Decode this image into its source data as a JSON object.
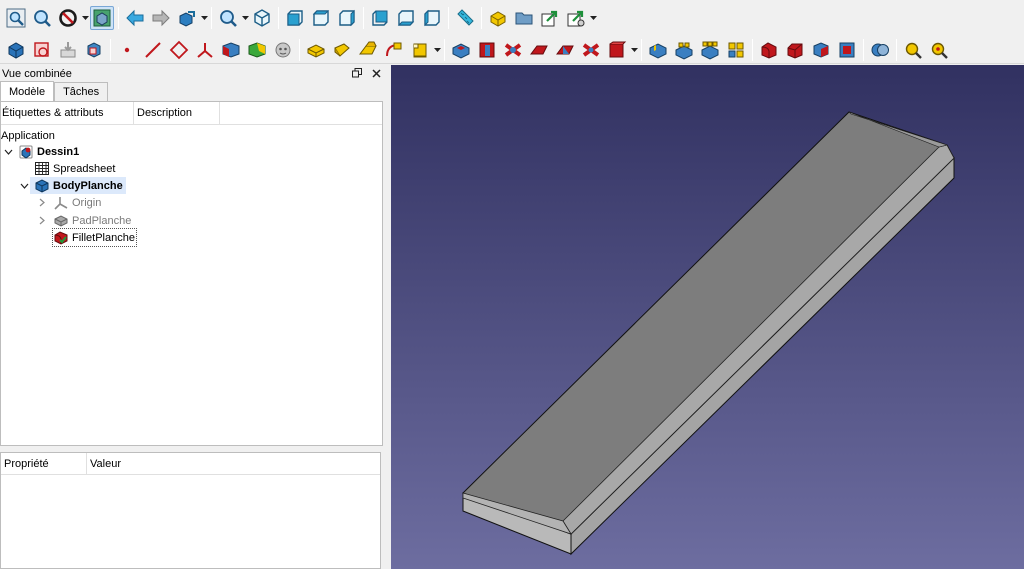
{
  "toolbars": {
    "row1": [
      "fit-all-icon",
      "fit-selection-icon",
      "draw-style-icon",
      "bounding-box-icon",
      "back-icon",
      "forward-icon",
      "sync-view-icon",
      "std-views-icon",
      "isometric-icon",
      "front-icon",
      "top-icon",
      "right-icon",
      "rear-icon",
      "bottom-icon",
      "left-icon",
      "measure-icon",
      "part-icon",
      "group-icon",
      "link-icon",
      "link-actions-icon"
    ],
    "row2": [
      "create-body-icon",
      "create-sketch-icon",
      "validate-sketch-icon",
      "attach-sketch-icon",
      "datum-point-icon",
      "datum-line-icon",
      "datum-plane-icon",
      "local-cs-icon",
      "shape-binder-icon",
      "subshape-binder-icon",
      "clone-icon",
      "pad-icon",
      "revolution-icon",
      "loft-icon",
      "pipe-icon",
      "helix-icon",
      "additive-primitive-icon",
      "pocket-icon",
      "hole-icon",
      "groove-icon",
      "subtractive-loft-icon",
      "subtractive-pipe-icon",
      "subtractive-primitive-icon",
      "mirrored-icon",
      "linear-pattern-icon",
      "polar-pattern-icon",
      "multitransform-icon",
      "fillet-icon",
      "chamfer-icon",
      "draft-icon",
      "thickness-icon",
      "boolean-icon",
      "sprocket-icon",
      "involute-gear-icon"
    ]
  },
  "combo_view": {
    "title": "Vue combinée",
    "tabs": [
      "Modèle",
      "Tâches"
    ],
    "selected_tab": "Modèle",
    "tree_headers": [
      "Étiquettes & attributs",
      "Description"
    ],
    "section": "Application",
    "tree": {
      "document": "Dessin1",
      "spreadsheet": "Spreadsheet",
      "body": "BodyPlanche",
      "origin": "Origin",
      "pad": "PadPlanche",
      "fillet": "FilletPlanche"
    },
    "property_headers": [
      "Propriété",
      "Valeur"
    ]
  },
  "colors": {
    "viewport_top": "#313161",
    "viewport_bottom": "#6d6da0",
    "plank_top": "#7d7d7d",
    "plank_front": "#b9b9b9",
    "plank_side": "#a8a8a8"
  }
}
